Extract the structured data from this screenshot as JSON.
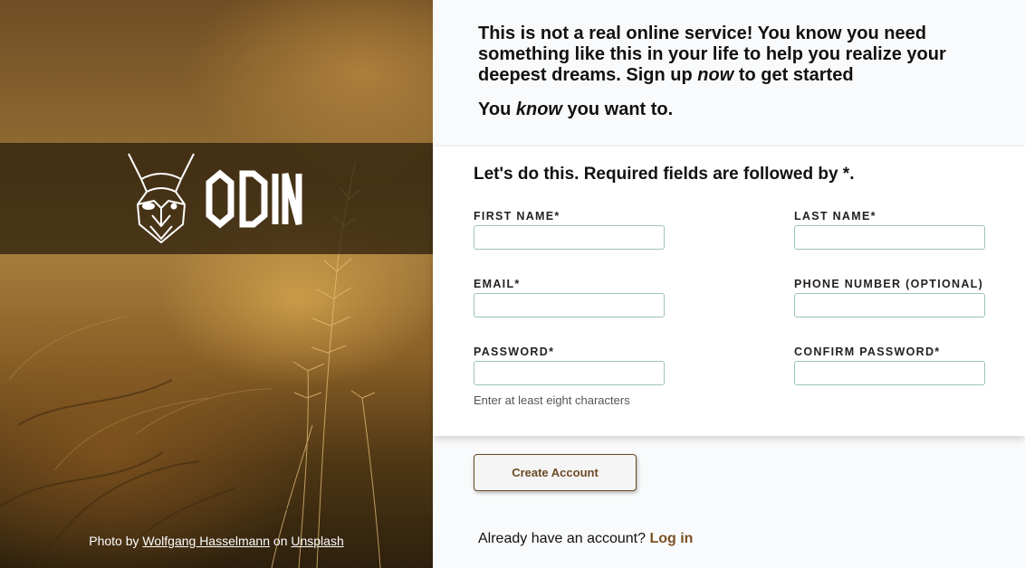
{
  "hero": {
    "logo_text": "ODIN",
    "credit": {
      "prefix": "Photo by",
      "author": "Wolfgang Hasselmann",
      "middle": "on",
      "source": "Unsplash"
    }
  },
  "intro": {
    "line1_before": "This is not a real online service! You know you need something like this in your life to help you realize your deepest dreams. Sign up",
    "line1_emph": "now",
    "line1_after": "to get started",
    "line2_before": "You",
    "line2_emph": "know",
    "line2_after": "you want to."
  },
  "form": {
    "heading": "Let's do this. Required fields are followed by *.",
    "fields": {
      "first_name": {
        "label": "FIRST NAME*",
        "value": ""
      },
      "last_name": {
        "label": "LAST NAME*",
        "value": ""
      },
      "email": {
        "label": "EMAIL*",
        "value": ""
      },
      "phone": {
        "label": "PHONE NUMBER (OPTIONAL)",
        "value": ""
      },
      "password": {
        "label": "PASSWORD*",
        "value": "",
        "hint": "Enter at least eight characters"
      },
      "confirm_password": {
        "label": "CONFIRM PASSWORD*",
        "value": ""
      }
    }
  },
  "actions": {
    "create_label": "Create Account",
    "login_prompt": "Already have an account?",
    "login_link": "Log in"
  },
  "colors": {
    "accent_brown": "#6b4a24",
    "input_border": "#9cc3bb",
    "page_bg": "#f9fafb"
  }
}
